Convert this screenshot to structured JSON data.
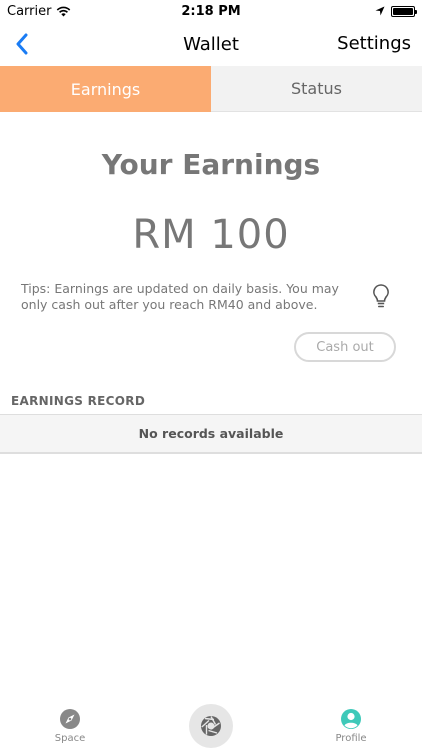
{
  "status_bar": {
    "carrier": "Carrier",
    "time": "2:18 PM",
    "icons": [
      "wifi-icon",
      "location-arrow-icon",
      "battery-icon"
    ]
  },
  "nav": {
    "title": "Wallet",
    "settings_label": "Settings",
    "back_icon": "chevron-left-icon",
    "accent": "#1a7cf4"
  },
  "tabs": [
    {
      "label": "Earnings",
      "active": true
    },
    {
      "label": "Status",
      "active": false
    }
  ],
  "earnings": {
    "heading": "Your Earnings",
    "amount": "RM 100",
    "tips": "Tips: Earnings are updated on daily basis. You may only cash out after you reach RM40 and above.",
    "tips_icon": "lightbulb-icon",
    "cashout_label": "Cash out"
  },
  "records": {
    "header": "EARNINGS RECORD",
    "empty_message": "No records available"
  },
  "tabbar": {
    "items": [
      {
        "label": "Space",
        "icon": "compass-icon",
        "color": "#888888"
      },
      {
        "label": "",
        "icon": "camera-aperture-icon",
        "color": "#e6e6e6"
      },
      {
        "label": "Profile",
        "icon": "profile-icon",
        "color": "#3ec9b9"
      }
    ]
  },
  "colors": {
    "active_tab": "#fbab72",
    "inactive_tab": "#f2f2f2",
    "text_gray": "#777777"
  }
}
